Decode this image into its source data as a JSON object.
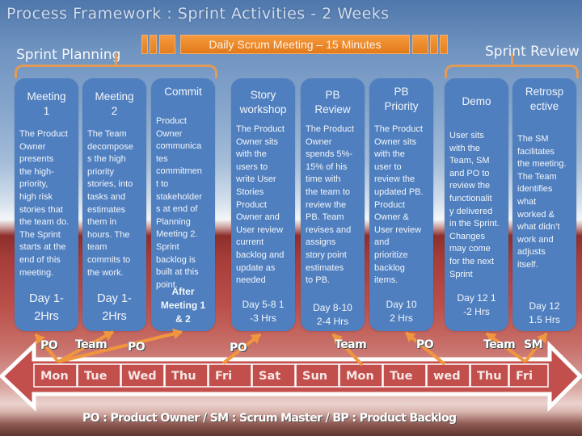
{
  "title": "Process Framework : Sprint Activities - 2 Weeks",
  "phases": {
    "planning": "Sprint Planning",
    "daily": "Daily Scrum Meeting – 15 Minutes",
    "review": "Sprint Review"
  },
  "colors": {
    "card": "#4f7fbf",
    "accent_orange": "#f0892c",
    "timeline_red": "#c24f4c"
  },
  "cards": [
    {
      "title": "Meeting 1",
      "title_lines": [
        "Meeting",
        "1"
      ],
      "body": [
        "The Product",
        "Owner",
        "presents",
        "the high-",
        "priority,",
        "high risk",
        "stories that",
        "the team do.",
        "The Sprint",
        "starts at the",
        "end of this",
        "meeting."
      ],
      "duration": [
        "Day 1-",
        "2Hrs"
      ]
    },
    {
      "title": "Meeting 2",
      "title_lines": [
        "Meeting",
        "2"
      ],
      "body": [
        "The Team",
        "decompose",
        "s the high",
        "priority",
        "stories, into",
        "tasks and",
        "estimates",
        "them in",
        "hours. The",
        "team",
        "commits to",
        "the work."
      ],
      "duration": [
        "Day 1-",
        "2Hrs"
      ]
    },
    {
      "title": "Commit",
      "title_lines": [
        "Commit"
      ],
      "body": [
        "Product",
        "Owner",
        "communica",
        "tes",
        "commitmen",
        "t to",
        "stakeholder",
        "s at end of",
        "Planning",
        "Meeting 2.",
        "Sprint",
        "backlog is",
        "built at this",
        "point."
      ],
      "duration": [
        "After",
        "Meeting 1",
        "& 2"
      ]
    },
    {
      "title": "Story workshop",
      "title_lines": [
        "Story",
        "workshop"
      ],
      "body": [
        "The Product",
        "Owner sits",
        "with the",
        "users to",
        "write User",
        "Stories",
        "Product",
        "Owner and",
        "User review",
        "current",
        "backlog and",
        "update as",
        "needed"
      ],
      "duration": [
        "Day 5-8  1",
        "-3 Hrs"
      ]
    },
    {
      "title": "PB Review",
      "title_lines": [
        "PB",
        "Review"
      ],
      "body": [
        "The Product",
        "Owner",
        "spends 5%-",
        "15% of his",
        "time with",
        "the team to",
        "review  the",
        "PB. Team",
        "revises and",
        "assigns",
        "story point",
        "estimates",
        "to PB."
      ],
      "duration": [
        "Day 8-10",
        "2-4 Hrs"
      ]
    },
    {
      "title": "PB Priority",
      "title_lines": [
        "PB",
        "Priority"
      ],
      "body": [
        "The Product",
        "Owner sits",
        "with the",
        "user to",
        "review the",
        "updated PB.",
        "Product",
        "Owner &",
        "User review",
        "and",
        "prioritize",
        "backlog",
        "items."
      ],
      "duration": [
        "Day  10",
        "2 Hrs"
      ]
    },
    {
      "title": "Demo",
      "title_lines": [
        "Demo"
      ],
      "body": [
        "User sits",
        "with the",
        "Team, SM",
        "and PO to",
        "review the",
        "functionalit",
        "y delivered",
        "in the Sprint.",
        "Changes",
        "may come",
        "for the next",
        "Sprint"
      ],
      "duration": [
        "Day 12  1",
        "-2 Hrs"
      ]
    },
    {
      "title": "Retrospective",
      "title_lines": [
        "Retrosp",
        "ective"
      ],
      "body": [
        "The SM",
        "facilitates",
        "the meeting.",
        "The Team",
        "identifies",
        "what",
        "worked  &",
        "what didn’t",
        "work and",
        "adjusts",
        "itself."
      ],
      "duration": [
        "Day 12",
        "1.5 Hrs"
      ]
    }
  ],
  "roles": [
    {
      "label": "PO"
    },
    {
      "label": "Team"
    },
    {
      "label": "PO"
    },
    {
      "label": "PO"
    },
    {
      "label": "Team"
    },
    {
      "label": "PO"
    },
    {
      "label": "Team"
    },
    {
      "label": "SM"
    }
  ],
  "days": [
    "Mon",
    "Tue",
    "Wed",
    "Thu",
    "Fri",
    "Sat",
    "Sun",
    "Mon",
    "Tue",
    "wed",
    "Thu",
    "Fri"
  ],
  "legend": "PO : Product Owner /  SM : Scrum Master  / BP : Product Backlog"
}
